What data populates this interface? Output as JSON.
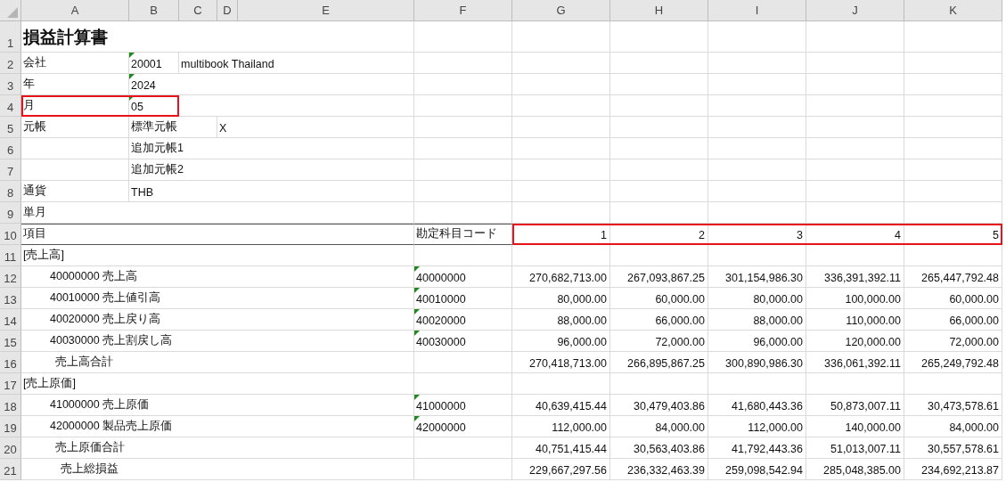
{
  "columns": [
    "A",
    "B",
    "C",
    "D",
    "E",
    "F",
    "G",
    "H",
    "I",
    "J",
    "K"
  ],
  "rows": [
    {
      "number": "1",
      "kind": "title",
      "cells": {
        "A": {
          "text": "損益計算書"
        }
      }
    },
    {
      "number": "2",
      "kind": "field",
      "cells": {
        "A": {
          "text": "会社"
        },
        "B": {
          "text": "20001",
          "flagged": true
        },
        "C": {
          "text": "multibook Thailand"
        }
      }
    },
    {
      "number": "3",
      "kind": "field",
      "cells": {
        "A": {
          "text": "年"
        },
        "B": {
          "text": "2024",
          "flagged": true
        }
      }
    },
    {
      "number": "4",
      "kind": "field",
      "cells": {
        "A": {
          "text": "月",
          "outlined": true
        },
        "B": {
          "text": "05",
          "flagged": true,
          "outlined": true
        }
      }
    },
    {
      "number": "5",
      "kind": "field",
      "cells": {
        "A": {
          "text": "元帳"
        },
        "B": {
          "text": "標準元帳"
        },
        "D": {
          "text": "X"
        }
      }
    },
    {
      "number": "6",
      "kind": "field",
      "cells": {
        "B": {
          "text": "追加元帳1"
        }
      }
    },
    {
      "number": "7",
      "kind": "field",
      "cells": {
        "B": {
          "text": "追加元帳2"
        }
      }
    },
    {
      "number": "8",
      "kind": "field",
      "cells": {
        "A": {
          "text": "通貨"
        },
        "B": {
          "text": "THB"
        }
      }
    },
    {
      "number": "9",
      "kind": "field",
      "cells": {
        "A": {
          "text": "単月"
        }
      }
    },
    {
      "number": "10",
      "kind": "header",
      "cells": {
        "A": {
          "text": "項目"
        },
        "F": {
          "text": "勘定科目コード"
        },
        "G": {
          "text": "1",
          "kind": "amount",
          "outlined": true
        },
        "H": {
          "text": "2",
          "kind": "amount",
          "outlined": true
        },
        "I": {
          "text": "3",
          "kind": "amount",
          "outlined": true
        },
        "J": {
          "text": "4",
          "kind": "amount",
          "outlined": true
        },
        "K": {
          "text": "5",
          "kind": "amount",
          "outlined": true
        }
      }
    },
    {
      "number": "11",
      "kind": "section",
      "cells": {
        "A": {
          "text": "[売上高]"
        }
      }
    },
    {
      "number": "12",
      "kind": "item",
      "cells": {
        "A": {
          "text": "40000000 売上高"
        },
        "F": {
          "text": "40000000",
          "flagged": true
        },
        "G": {
          "text": "270,682,713.00",
          "kind": "amount"
        },
        "H": {
          "text": "267,093,867.25",
          "kind": "amount"
        },
        "I": {
          "text": "301,154,986.30",
          "kind": "amount"
        },
        "J": {
          "text": "336,391,392.11",
          "kind": "amount"
        },
        "K": {
          "text": "265,447,792.48",
          "kind": "amount"
        }
      }
    },
    {
      "number": "13",
      "kind": "item",
      "cells": {
        "A": {
          "text": "40010000 売上値引高"
        },
        "F": {
          "text": "40010000",
          "flagged": true
        },
        "G": {
          "text": "80,000.00",
          "kind": "amount"
        },
        "H": {
          "text": "60,000.00",
          "kind": "amount"
        },
        "I": {
          "text": "80,000.00",
          "kind": "amount"
        },
        "J": {
          "text": "100,000.00",
          "kind": "amount"
        },
        "K": {
          "text": "60,000.00",
          "kind": "amount"
        }
      }
    },
    {
      "number": "14",
      "kind": "item",
      "cells": {
        "A": {
          "text": "40020000 売上戻り高"
        },
        "F": {
          "text": "40020000",
          "flagged": true
        },
        "G": {
          "text": "88,000.00",
          "kind": "amount"
        },
        "H": {
          "text": "66,000.00",
          "kind": "amount"
        },
        "I": {
          "text": "88,000.00",
          "kind": "amount"
        },
        "J": {
          "text": "110,000.00",
          "kind": "amount"
        },
        "K": {
          "text": "66,000.00",
          "kind": "amount"
        }
      }
    },
    {
      "number": "15",
      "kind": "item",
      "cells": {
        "A": {
          "text": "40030000 売上割戻し高"
        },
        "F": {
          "text": "40030000",
          "flagged": true
        },
        "G": {
          "text": "96,000.00",
          "kind": "amount"
        },
        "H": {
          "text": "72,000.00",
          "kind": "amount"
        },
        "I": {
          "text": "96,000.00",
          "kind": "amount"
        },
        "J": {
          "text": "120,000.00",
          "kind": "amount"
        },
        "K": {
          "text": "72,000.00",
          "kind": "amount"
        }
      }
    },
    {
      "number": "16",
      "kind": "subtotal",
      "cells": {
        "A": {
          "text": "売上高合計"
        },
        "G": {
          "text": "270,418,713.00",
          "kind": "amount"
        },
        "H": {
          "text": "266,895,867.25",
          "kind": "amount"
        },
        "I": {
          "text": "300,890,986.30",
          "kind": "amount"
        },
        "J": {
          "text": "336,061,392.11",
          "kind": "amount"
        },
        "K": {
          "text": "265,249,792.48",
          "kind": "amount"
        }
      }
    },
    {
      "number": "17",
      "kind": "section",
      "cells": {
        "A": {
          "text": "[売上原価]"
        }
      }
    },
    {
      "number": "18",
      "kind": "item",
      "cells": {
        "A": {
          "text": "41000000 売上原価"
        },
        "F": {
          "text": "41000000",
          "flagged": true
        },
        "G": {
          "text": "40,639,415.44",
          "kind": "amount"
        },
        "H": {
          "text": "30,479,403.86",
          "kind": "amount"
        },
        "I": {
          "text": "41,680,443.36",
          "kind": "amount"
        },
        "J": {
          "text": "50,873,007.11",
          "kind": "amount"
        },
        "K": {
          "text": "30,473,578.61",
          "kind": "amount"
        }
      }
    },
    {
      "number": "19",
      "kind": "item",
      "cells": {
        "A": {
          "text": "42000000 製品売上原価"
        },
        "F": {
          "text": "42000000",
          "flagged": true
        },
        "G": {
          "text": "112,000.00",
          "kind": "amount"
        },
        "H": {
          "text": "84,000.00",
          "kind": "amount"
        },
        "I": {
          "text": "112,000.00",
          "kind": "amount"
        },
        "J": {
          "text": "140,000.00",
          "kind": "amount"
        },
        "K": {
          "text": "84,000.00",
          "kind": "amount"
        }
      }
    },
    {
      "number": "20",
      "kind": "subtotal",
      "cells": {
        "A": {
          "text": "売上原価合計"
        },
        "G": {
          "text": "40,751,415.44",
          "kind": "amount"
        },
        "H": {
          "text": "30,563,403.86",
          "kind": "amount"
        },
        "I": {
          "text": "41,792,443.36",
          "kind": "amount"
        },
        "J": {
          "text": "51,013,007.11",
          "kind": "amount"
        },
        "K": {
          "text": "30,557,578.61",
          "kind": "amount"
        }
      }
    },
    {
      "number": "21",
      "kind": "total",
      "cells": {
        "A": {
          "text": "売上総損益"
        },
        "G": {
          "text": "229,667,297.56",
          "kind": "amount"
        },
        "H": {
          "text": "236,332,463.39",
          "kind": "amount"
        },
        "I": {
          "text": "259,098,542.94",
          "kind": "amount"
        },
        "J": {
          "text": "285,048,385.00",
          "kind": "amount"
        },
        "K": {
          "text": "234,692,213.87",
          "kind": "amount"
        }
      }
    }
  ]
}
